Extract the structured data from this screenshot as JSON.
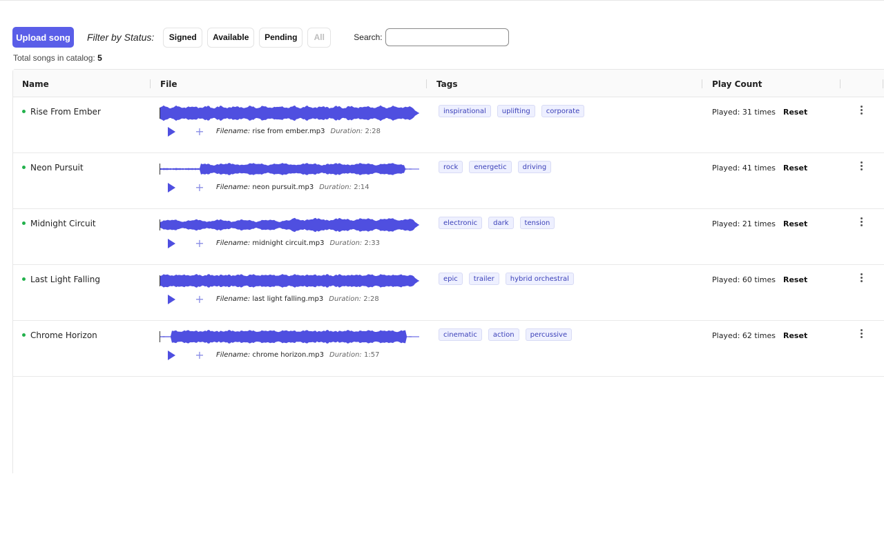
{
  "toolbar": {
    "upload_label": "Upload song",
    "filter_label": "Filter by Status:",
    "filters": [
      {
        "label": "Signed",
        "active": true
      },
      {
        "label": "Available",
        "active": true
      },
      {
        "label": "Pending",
        "active": true
      },
      {
        "label": "All",
        "active": false
      }
    ],
    "search_label": "Search:",
    "search_value": ""
  },
  "summary": {
    "label": "Total songs in catalog:",
    "count": "5"
  },
  "table": {
    "columns": [
      "Name",
      "File",
      "Tags",
      "Play Count"
    ],
    "filename_label": "Filename:",
    "duration_label": "Duration:",
    "reset_label": "Reset",
    "rows": [
      {
        "name": "Rise From Ember",
        "filename": "rise from ember.mp3",
        "duration": "2:28",
        "tags": [
          "inspirational",
          "uplifting",
          "corporate"
        ],
        "played": "Played: 31 times"
      },
      {
        "name": "Neon Pursuit",
        "filename": "neon pursuit.mp3",
        "duration": "2:14",
        "tags": [
          "rock",
          "energetic",
          "driving"
        ],
        "played": "Played: 41 times"
      },
      {
        "name": "Midnight Circuit",
        "filename": "midnight circuit.mp3",
        "duration": "2:33",
        "tags": [
          "electronic",
          "dark",
          "tension"
        ],
        "played": "Played: 21 times"
      },
      {
        "name": "Last Light Falling",
        "filename": "last light falling.mp3",
        "duration": "2:28",
        "tags": [
          "epic",
          "trailer",
          "hybrid orchestral"
        ],
        "played": "Played: 60 times"
      },
      {
        "name": "Chrome Horizon",
        "filename": "chrome horizon.mp3",
        "duration": "1:57",
        "tags": [
          "cinematic",
          "action",
          "percussive"
        ],
        "played": "Played: 62 times"
      }
    ]
  },
  "colors": {
    "accent": "#5a5ee8",
    "waveform": "#4f4fe0",
    "status_dot": "#22b14c",
    "tag_text": "#3a3fb8"
  },
  "icons": {
    "play": "play-icon",
    "add": "plus-icon",
    "more": "kebab-menu-icon",
    "status": "status-dot-icon"
  }
}
